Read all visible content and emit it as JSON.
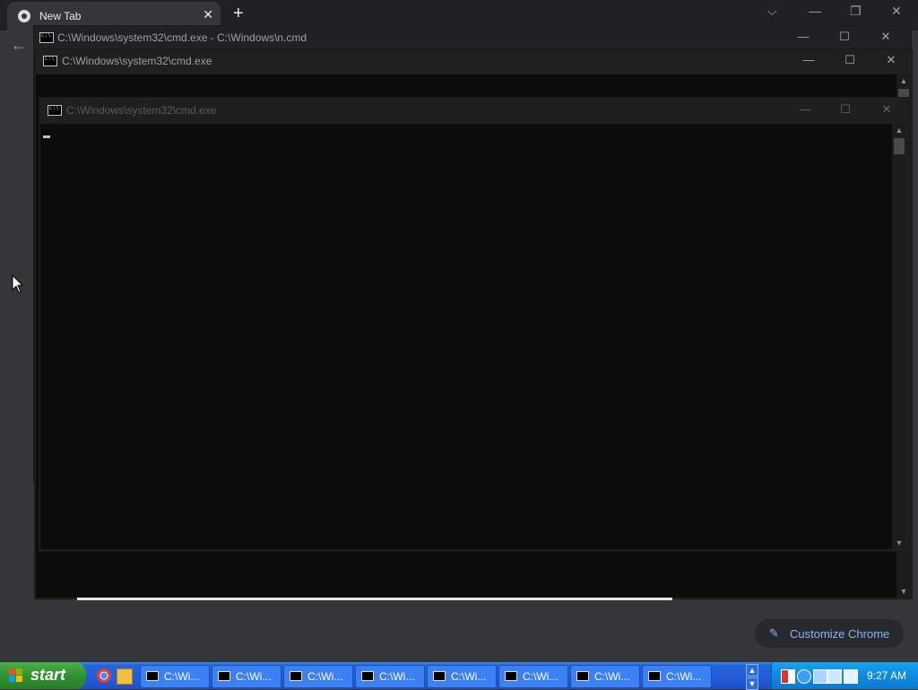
{
  "browser": {
    "tab_title": "New Tab",
    "tab_close": "✕",
    "new_tab": "+",
    "back": "←",
    "customize_label": "Customize Chrome",
    "customize_icon": "pencil-icon",
    "window_controls": {
      "dropdown": "⌵",
      "minimize": "—",
      "restore": "❐",
      "close": "✕"
    }
  },
  "windows": [
    {
      "title": "C:\\Windows\\system32\\cmd.exe - C:\\Windows\\n.cmd"
    },
    {
      "title": "C:\\Windows\\system32\\cmd.exe"
    },
    {
      "title": "C:\\Windows\\system32\\cmd.exe"
    }
  ],
  "window_controls": {
    "minimize": "—",
    "maximize": "☐",
    "close": "✕"
  },
  "scroll": {
    "up": "▲",
    "down": "▼"
  },
  "taskbar": {
    "start_label": "start",
    "tasks": [
      "C:\\Wi...",
      "C:\\Wi...",
      "C:\\Wi...",
      "C:\\Wi...",
      "C:\\Wi...",
      "C:\\Wi...",
      "C:\\Wi...",
      "C:\\Wi..."
    ],
    "scroll_up": "▲",
    "scroll_down": "▼",
    "clock": "9:27 AM"
  },
  "colors": {
    "taskbar": "#245edb",
    "start": "#3c9a3c",
    "tray": "#0f8ae0",
    "accent": "#8ab4f8"
  }
}
